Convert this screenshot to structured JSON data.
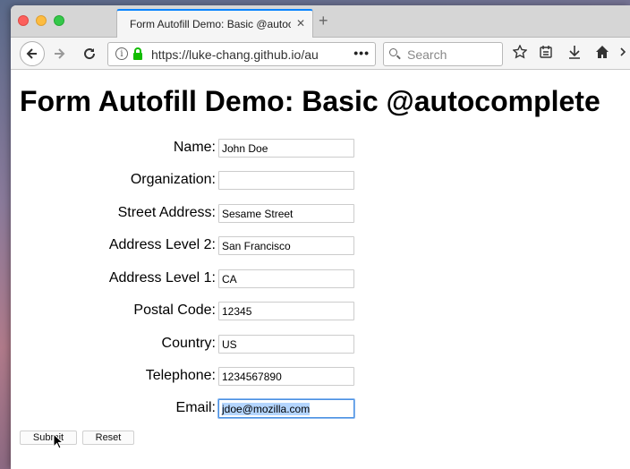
{
  "browser": {
    "tab_title": "Form Autofill Demo: Basic @autoc",
    "tab_close": "✕",
    "new_tab": "+",
    "url": "https://luke-chang.github.io/au",
    "url_more": "•••",
    "search_placeholder": "Search"
  },
  "page": {
    "title": "Form Autofill Demo: Basic @autocomplete"
  },
  "form": {
    "fields": [
      {
        "label": "Name:",
        "value": "John Doe"
      },
      {
        "label": "Organization:",
        "value": ""
      },
      {
        "label": "Street Address:",
        "value": "Sesame Street"
      },
      {
        "label": "Address Level 2:",
        "value": "San Francisco"
      },
      {
        "label": "Address Level 1:",
        "value": "CA"
      },
      {
        "label": "Postal Code:",
        "value": "12345"
      },
      {
        "label": "Country:",
        "value": "US"
      },
      {
        "label": "Telephone:",
        "value": "1234567890"
      },
      {
        "label": "Email:",
        "value": "jdoe@mozilla.com"
      }
    ],
    "submit_label": "Submit",
    "reset_label": "Reset"
  },
  "colors": {
    "accent": "#0a84ff",
    "lock": "#12bc00",
    "selection": "#b4d5fe"
  }
}
